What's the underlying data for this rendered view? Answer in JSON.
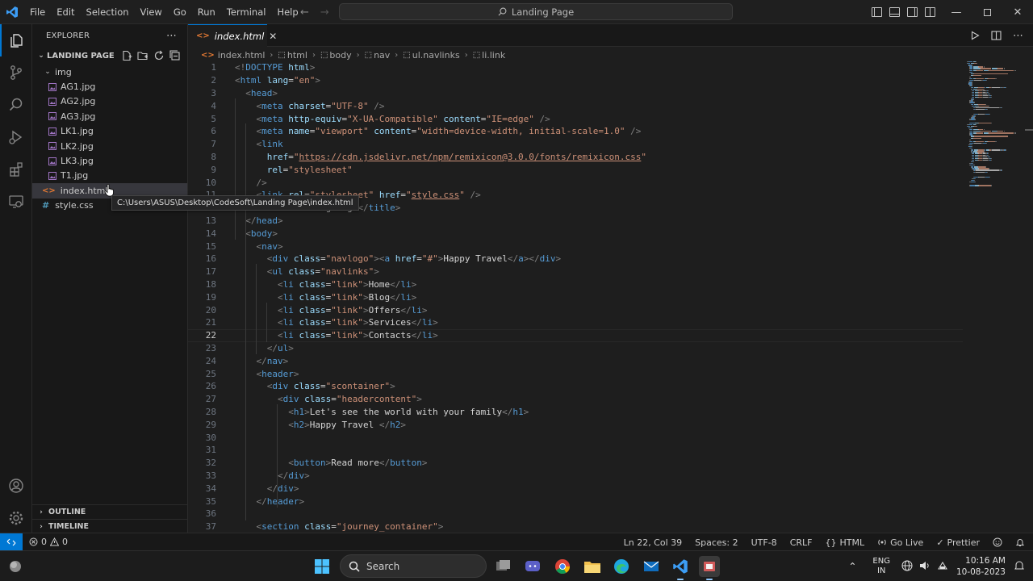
{
  "titlebar": {
    "menu": [
      "File",
      "Edit",
      "Selection",
      "View",
      "Go",
      "Run",
      "Terminal",
      "Help"
    ],
    "search_text": "Landing Page"
  },
  "explorer": {
    "title": "EXPLORER",
    "folder": "LANDING PAGE",
    "subfolder": "img",
    "img_files": [
      "AG1.jpg",
      "AG2.jpg",
      "AG3.jpg",
      "LK1.jpg",
      "LK2.jpg",
      "LK3.jpg",
      "T1.jpg"
    ],
    "root_files": [
      "index.html",
      "style.css"
    ],
    "outline": "OUTLINE",
    "timeline": "TIMELINE"
  },
  "tooltip": "C:\\Users\\ASUS\\Desktop\\CodeSoft\\Landing Page\\index.html",
  "tab": {
    "label": "index.html"
  },
  "breadcrumb": [
    "index.html",
    "html",
    "body",
    "nav",
    "ul.navlinks",
    "li.link"
  ],
  "editor": {
    "current_line": 22,
    "lines": [
      [
        [
          "br",
          "<!"
        ],
        [
          "tag",
          "DOCTYPE"
        ],
        [
          "txt",
          " "
        ],
        [
          "attr",
          "html"
        ],
        [
          "br",
          ">"
        ]
      ],
      [
        [
          "br",
          "<"
        ],
        [
          "tag",
          "html"
        ],
        [
          "txt",
          " "
        ],
        [
          "attr",
          "lang"
        ],
        [
          "txt",
          "="
        ],
        [
          "str",
          "\"en\""
        ],
        [
          "br",
          ">"
        ]
      ],
      [
        [
          "txt",
          "  "
        ],
        [
          "br",
          "<"
        ],
        [
          "tag",
          "head"
        ],
        [
          "br",
          ">"
        ]
      ],
      [
        [
          "txt",
          "    "
        ],
        [
          "br",
          "<"
        ],
        [
          "tag",
          "meta"
        ],
        [
          "txt",
          " "
        ],
        [
          "attr",
          "charset"
        ],
        [
          "txt",
          "="
        ],
        [
          "str",
          "\"UTF-8\""
        ],
        [
          "txt",
          " "
        ],
        [
          "br",
          "/>"
        ]
      ],
      [
        [
          "txt",
          "    "
        ],
        [
          "br",
          "<"
        ],
        [
          "tag",
          "meta"
        ],
        [
          "txt",
          " "
        ],
        [
          "attr",
          "http-equiv"
        ],
        [
          "txt",
          "="
        ],
        [
          "str",
          "\"X-UA-Compatible\""
        ],
        [
          "txt",
          " "
        ],
        [
          "attr",
          "content"
        ],
        [
          "txt",
          "="
        ],
        [
          "str",
          "\"IE=edge\""
        ],
        [
          "txt",
          " "
        ],
        [
          "br",
          "/>"
        ]
      ],
      [
        [
          "txt",
          "    "
        ],
        [
          "br",
          "<"
        ],
        [
          "tag",
          "meta"
        ],
        [
          "txt",
          " "
        ],
        [
          "attr",
          "name"
        ],
        [
          "txt",
          "="
        ],
        [
          "str",
          "\"viewport\""
        ],
        [
          "txt",
          " "
        ],
        [
          "attr",
          "content"
        ],
        [
          "txt",
          "="
        ],
        [
          "str",
          "\"width=device-width, initial-scale=1.0\""
        ],
        [
          "txt",
          " "
        ],
        [
          "br",
          "/>"
        ]
      ],
      [
        [
          "txt",
          "    "
        ],
        [
          "br",
          "<"
        ],
        [
          "tag",
          "link"
        ]
      ],
      [
        [
          "txt",
          "      "
        ],
        [
          "attr",
          "href"
        ],
        [
          "txt",
          "="
        ],
        [
          "str",
          "\""
        ],
        [
          "url",
          "https://cdn.jsdelivr.net/npm/remixicon@3.0.0/fonts/remixicon.css"
        ],
        [
          "str",
          "\""
        ]
      ],
      [
        [
          "txt",
          "      "
        ],
        [
          "attr",
          "rel"
        ],
        [
          "txt",
          "="
        ],
        [
          "str",
          "\"stylesheet\""
        ]
      ],
      [
        [
          "txt",
          "    "
        ],
        [
          "br",
          "/>"
        ]
      ],
      [
        [
          "txt",
          "    "
        ],
        [
          "br",
          "<"
        ],
        [
          "tag",
          "link"
        ],
        [
          "txt",
          " "
        ],
        [
          "attr",
          "rel"
        ],
        [
          "txt",
          "="
        ],
        [
          "str",
          "\"stylesheet\""
        ],
        [
          "txt",
          " "
        ],
        [
          "attr",
          "href"
        ],
        [
          "txt",
          "="
        ],
        [
          "str",
          "\""
        ],
        [
          "url",
          "style.css"
        ],
        [
          "str",
          "\""
        ],
        [
          "txt",
          " "
        ],
        [
          "br",
          "/>"
        ]
      ],
      [
        [
          "txt",
          "    "
        ],
        [
          "br",
          "<"
        ],
        [
          "tag",
          "title"
        ],
        [
          "br",
          ">"
        ],
        [
          "txt",
          "Landing Page"
        ],
        [
          "br",
          "</"
        ],
        [
          "tag",
          "title"
        ],
        [
          "br",
          ">"
        ]
      ],
      [
        [
          "txt",
          "  "
        ],
        [
          "br",
          "</"
        ],
        [
          "tag",
          "head"
        ],
        [
          "br",
          ">"
        ]
      ],
      [
        [
          "txt",
          "  "
        ],
        [
          "br",
          "<"
        ],
        [
          "tag",
          "body"
        ],
        [
          "br",
          ">"
        ]
      ],
      [
        [
          "txt",
          "    "
        ],
        [
          "br",
          "<"
        ],
        [
          "tag",
          "nav"
        ],
        [
          "br",
          ">"
        ]
      ],
      [
        [
          "txt",
          "      "
        ],
        [
          "br",
          "<"
        ],
        [
          "tag",
          "div"
        ],
        [
          "txt",
          " "
        ],
        [
          "attr",
          "class"
        ],
        [
          "txt",
          "="
        ],
        [
          "str",
          "\"navlogo\""
        ],
        [
          "br",
          "><"
        ],
        [
          "tag",
          "a"
        ],
        [
          "txt",
          " "
        ],
        [
          "attr",
          "href"
        ],
        [
          "txt",
          "="
        ],
        [
          "str",
          "\"#\""
        ],
        [
          "br",
          ">"
        ],
        [
          "txt",
          "Happy Travel"
        ],
        [
          "br",
          "</"
        ],
        [
          "tag",
          "a"
        ],
        [
          "br",
          "></"
        ],
        [
          "tag",
          "div"
        ],
        [
          "br",
          ">"
        ]
      ],
      [
        [
          "txt",
          "      "
        ],
        [
          "br",
          "<"
        ],
        [
          "tag",
          "ul"
        ],
        [
          "txt",
          " "
        ],
        [
          "attr",
          "class"
        ],
        [
          "txt",
          "="
        ],
        [
          "str",
          "\"navlinks\""
        ],
        [
          "br",
          ">"
        ]
      ],
      [
        [
          "txt",
          "        "
        ],
        [
          "br",
          "<"
        ],
        [
          "tag",
          "li"
        ],
        [
          "txt",
          " "
        ],
        [
          "attr",
          "class"
        ],
        [
          "txt",
          "="
        ],
        [
          "str",
          "\"link\""
        ],
        [
          "br",
          ">"
        ],
        [
          "txt",
          "Home"
        ],
        [
          "br",
          "</"
        ],
        [
          "tag",
          "li"
        ],
        [
          "br",
          ">"
        ]
      ],
      [
        [
          "txt",
          "        "
        ],
        [
          "br",
          "<"
        ],
        [
          "tag",
          "li"
        ],
        [
          "txt",
          " "
        ],
        [
          "attr",
          "class"
        ],
        [
          "txt",
          "="
        ],
        [
          "str",
          "\"link\""
        ],
        [
          "br",
          ">"
        ],
        [
          "txt",
          "Blog"
        ],
        [
          "br",
          "</"
        ],
        [
          "tag",
          "li"
        ],
        [
          "br",
          ">"
        ]
      ],
      [
        [
          "txt",
          "        "
        ],
        [
          "br",
          "<"
        ],
        [
          "tag",
          "li"
        ],
        [
          "txt",
          " "
        ],
        [
          "attr",
          "class"
        ],
        [
          "txt",
          "="
        ],
        [
          "str",
          "\"link\""
        ],
        [
          "br",
          ">"
        ],
        [
          "txt",
          "Offers"
        ],
        [
          "br",
          "</"
        ],
        [
          "tag",
          "li"
        ],
        [
          "br",
          ">"
        ]
      ],
      [
        [
          "txt",
          "        "
        ],
        [
          "br",
          "<"
        ],
        [
          "tag",
          "li"
        ],
        [
          "txt",
          " "
        ],
        [
          "attr",
          "class"
        ],
        [
          "txt",
          "="
        ],
        [
          "str",
          "\"link\""
        ],
        [
          "br",
          ">"
        ],
        [
          "txt",
          "Services"
        ],
        [
          "br",
          "</"
        ],
        [
          "tag",
          "li"
        ],
        [
          "br",
          ">"
        ]
      ],
      [
        [
          "txt",
          "        "
        ],
        [
          "br",
          "<"
        ],
        [
          "tag",
          "li"
        ],
        [
          "txt",
          " "
        ],
        [
          "attr",
          "class"
        ],
        [
          "txt",
          "="
        ],
        [
          "str",
          "\"link\""
        ],
        [
          "br",
          ">"
        ],
        [
          "txt",
          "Contacts"
        ],
        [
          "br",
          "</"
        ],
        [
          "tag",
          "li"
        ],
        [
          "br",
          ">"
        ]
      ],
      [
        [
          "txt",
          "      "
        ],
        [
          "br",
          "</"
        ],
        [
          "tag",
          "ul"
        ],
        [
          "br",
          ">"
        ]
      ],
      [
        [
          "txt",
          "    "
        ],
        [
          "br",
          "</"
        ],
        [
          "tag",
          "nav"
        ],
        [
          "br",
          ">"
        ]
      ],
      [
        [
          "txt",
          "    "
        ],
        [
          "br",
          "<"
        ],
        [
          "tag",
          "header"
        ],
        [
          "br",
          ">"
        ]
      ],
      [
        [
          "txt",
          "      "
        ],
        [
          "br",
          "<"
        ],
        [
          "tag",
          "div"
        ],
        [
          "txt",
          " "
        ],
        [
          "attr",
          "class"
        ],
        [
          "txt",
          "="
        ],
        [
          "str",
          "\"scontainer\""
        ],
        [
          "br",
          ">"
        ]
      ],
      [
        [
          "txt",
          "        "
        ],
        [
          "br",
          "<"
        ],
        [
          "tag",
          "div"
        ],
        [
          "txt",
          " "
        ],
        [
          "attr",
          "class"
        ],
        [
          "txt",
          "="
        ],
        [
          "str",
          "\"headercontent\""
        ],
        [
          "br",
          ">"
        ]
      ],
      [
        [
          "txt",
          "          "
        ],
        [
          "br",
          "<"
        ],
        [
          "tag",
          "h1"
        ],
        [
          "br",
          ">"
        ],
        [
          "txt",
          "Let's see the world with your family"
        ],
        [
          "br",
          "</"
        ],
        [
          "tag",
          "h1"
        ],
        [
          "br",
          ">"
        ]
      ],
      [
        [
          "txt",
          "          "
        ],
        [
          "br",
          "<"
        ],
        [
          "tag",
          "h2"
        ],
        [
          "br",
          ">"
        ],
        [
          "txt",
          "Happy Travel "
        ],
        [
          "br",
          "</"
        ],
        [
          "tag",
          "h2"
        ],
        [
          "br",
          ">"
        ]
      ],
      [],
      [],
      [
        [
          "txt",
          "          "
        ],
        [
          "br",
          "<"
        ],
        [
          "tag",
          "button"
        ],
        [
          "br",
          ">"
        ],
        [
          "txt",
          "Read more"
        ],
        [
          "br",
          "</"
        ],
        [
          "tag",
          "button"
        ],
        [
          "br",
          ">"
        ]
      ],
      [
        [
          "txt",
          "        "
        ],
        [
          "br",
          "</"
        ],
        [
          "tag",
          "div"
        ],
        [
          "br",
          ">"
        ]
      ],
      [
        [
          "txt",
          "      "
        ],
        [
          "br",
          "</"
        ],
        [
          "tag",
          "div"
        ],
        [
          "br",
          ">"
        ]
      ],
      [
        [
          "txt",
          "    "
        ],
        [
          "br",
          "</"
        ],
        [
          "tag",
          "header"
        ],
        [
          "br",
          ">"
        ]
      ],
      [],
      [
        [
          "txt",
          "    "
        ],
        [
          "br",
          "<"
        ],
        [
          "tag",
          "section"
        ],
        [
          "txt",
          " "
        ],
        [
          "attr",
          "class"
        ],
        [
          "txt",
          "="
        ],
        [
          "str",
          "\"journey_container\""
        ],
        [
          "br",
          ">"
        ]
      ]
    ]
  },
  "status": {
    "errors": "0",
    "warnings": "0",
    "position": "Ln 22, Col 39",
    "spaces": "Spaces: 2",
    "encoding": "UTF-8",
    "eol": "CRLF",
    "language": "HTML",
    "golive": "Go Live",
    "prettier": "Prettier"
  },
  "taskbar": {
    "search": "Search",
    "lang_1": "ENG",
    "lang_2": "IN",
    "time": "10:16 AM",
    "date": "10-08-2023"
  },
  "colors": {
    "accent": "#0078d4",
    "tag": "#569cd6",
    "attribute": "#9cdcfe",
    "string": "#ce9178"
  }
}
